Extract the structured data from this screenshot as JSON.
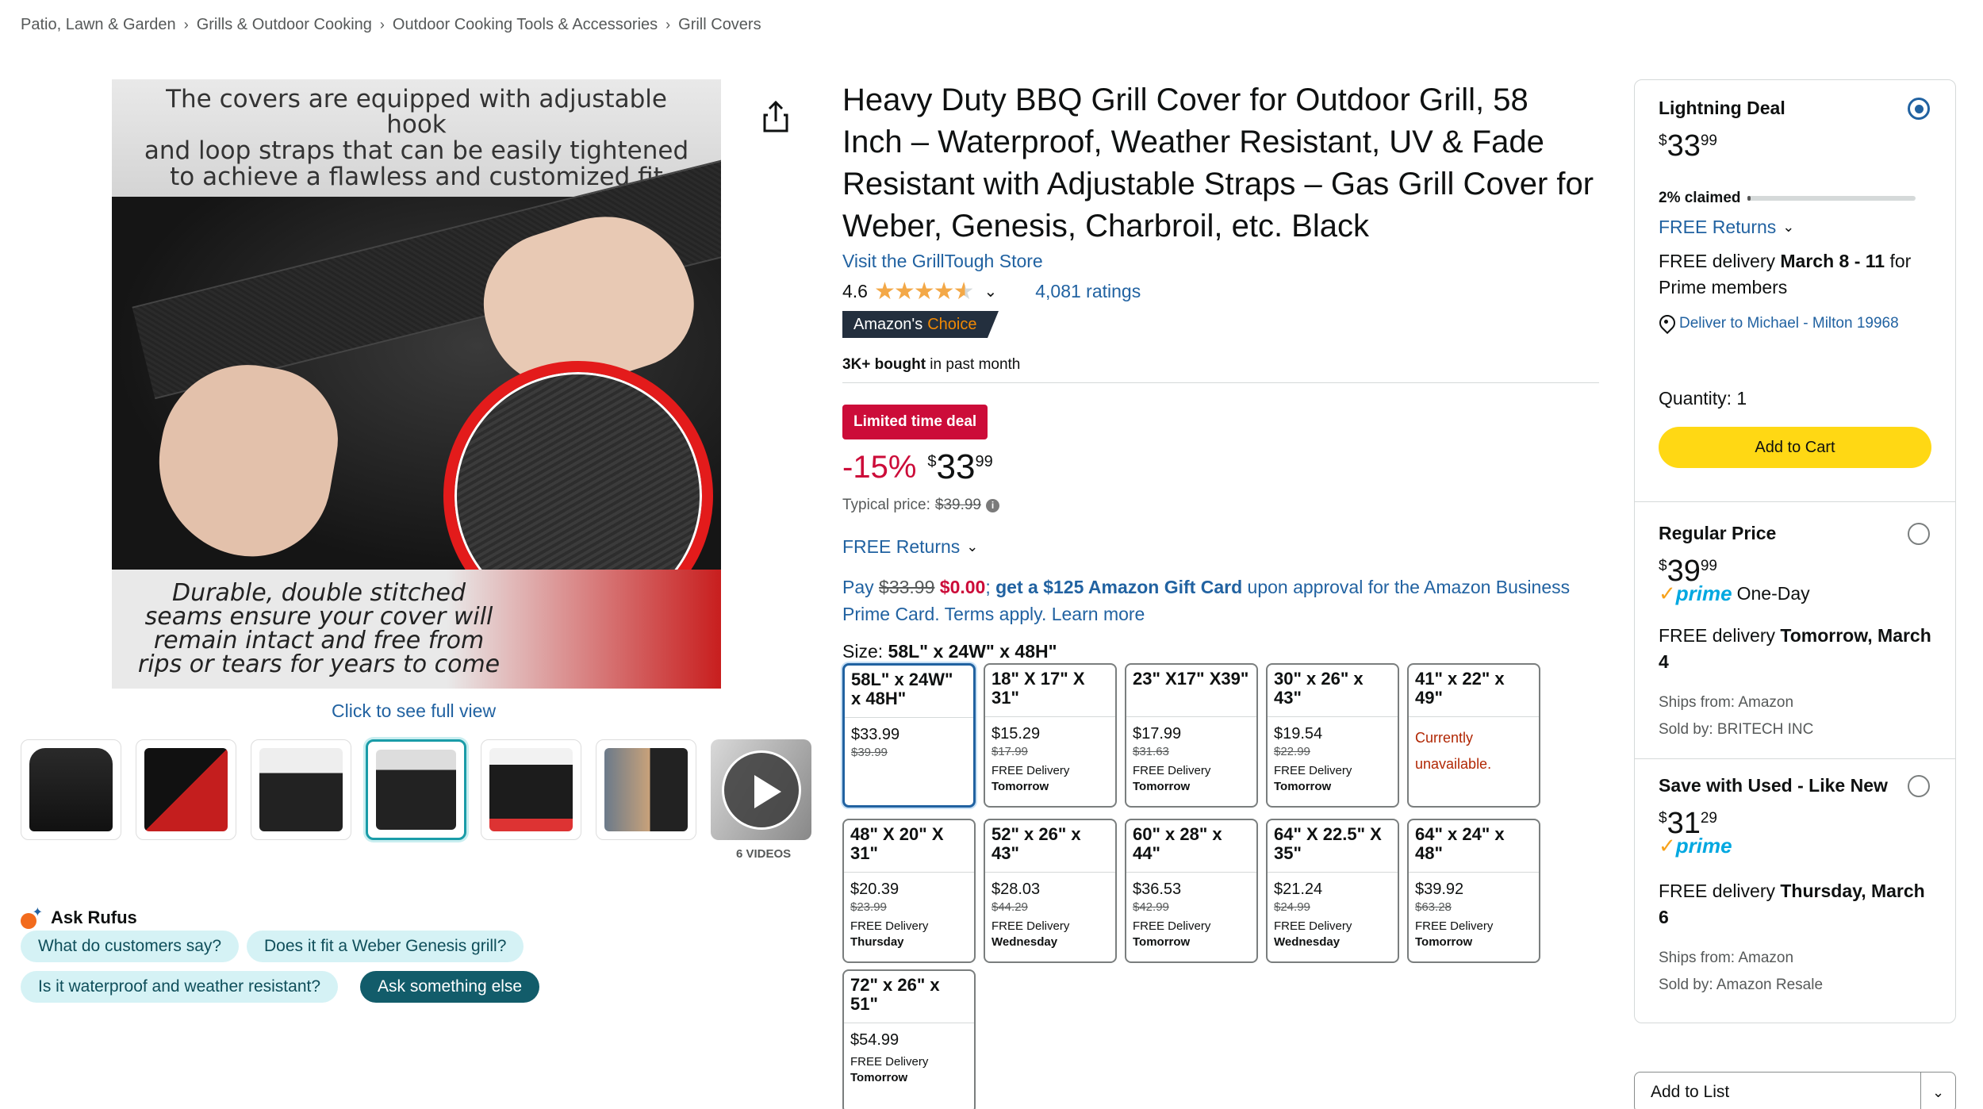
{
  "breadcrumb": [
    "Patio, Lawn & Garden",
    "Grills & Outdoor Cooking",
    "Outdoor Cooking Tools & Accessories",
    "Grill Covers"
  ],
  "main_image": {
    "top_text_1": "The covers are equipped with adjustable hook",
    "top_text_2": "and loop straps that can be easily tightened",
    "top_text_3": "to achieve a flawless and customized fit",
    "bottom_text_1": "Durable, double stitched",
    "bottom_text_2": "seams ensure your cover will",
    "bottom_text_3": "remain intact and free from",
    "bottom_text_4": "rips or tears for years to come"
  },
  "click_full_view": "Click to see full view",
  "videos_label": "6 VIDEOS",
  "rufus": {
    "title": "Ask Rufus",
    "chips": [
      "What do customers say?",
      "Does it fit a Weber Genesis grill?",
      "Is it waterproof and weather resistant?",
      "Ask something else"
    ]
  },
  "product": {
    "title": "Heavy Duty BBQ Grill Cover for Outdoor Grill, 58 Inch – Waterproof, Weather Resistant, UV & Fade Resistant with Adjustable Straps – Gas Grill Cover for Weber, Genesis, Charbroil, etc. Black",
    "store": "Visit the GrillTough Store",
    "rating": "4.6",
    "rating_value": 4.6,
    "ratings_count": "4,081 ratings",
    "choice_1": "Amazon's",
    "choice_2": "Choice",
    "bought_bold": "3K+ bought",
    "bought_rest": " in past month",
    "deal_badge": "Limited time deal",
    "discount": "-15%",
    "currency": "$",
    "price_whole": "33",
    "price_cents": "99",
    "typical_label": "Typical price:",
    "typical_price": "$39.99",
    "free_returns": "FREE Returns",
    "promo": {
      "pay": "Pay ",
      "old": "$33.99",
      "new": "$0.00",
      "semi": "; ",
      "get": "get a $125 Amazon Gift Card",
      "rest": " upon approval for the Amazon Business Prime Card. Terms apply. Learn more"
    },
    "size_label": "Size:",
    "size_value": "58L\" x 24W\" x 48H\""
  },
  "sizes": [
    {
      "size": "58L\" x 24W\" x 48H\"",
      "price": "$33.99",
      "was": "$39.99",
      "d1": "",
      "d2": "",
      "unavailable": ""
    },
    {
      "size": "18\" X 17\" X 31\"",
      "price": "$15.29",
      "was": "$17.99",
      "d1": "FREE Delivery",
      "d2": "Tomorrow",
      "unavailable": ""
    },
    {
      "size": "23\" X17\" X39\"",
      "price": "$17.99",
      "was": "$31.63",
      "d1": "FREE Delivery",
      "d2": "Tomorrow",
      "unavailable": ""
    },
    {
      "size": "30\" x 26\" x 43\"",
      "price": "$19.54",
      "was": "$22.99",
      "d1": "FREE Delivery",
      "d2": "Tomorrow",
      "unavailable": ""
    },
    {
      "size": "41\" x 22\" x 49\"",
      "price": "",
      "was": "",
      "d1": "",
      "d2": "",
      "unavailable": "Currently unavailable."
    },
    {
      "size": "48\" X 20\" X 31\"",
      "price": "$20.39",
      "was": "$23.99",
      "d1": "FREE Delivery",
      "d2": "Thursday",
      "unavailable": ""
    },
    {
      "size": "52\" x 26\" x 43\"",
      "price": "$28.03",
      "was": "$44.29",
      "d1": "FREE Delivery",
      "d2": "Wednesday",
      "unavailable": ""
    },
    {
      "size": "60\" x 28\" x 44\"",
      "price": "$36.53",
      "was": "$42.99",
      "d1": "FREE Delivery",
      "d2": "Tomorrow",
      "unavailable": ""
    },
    {
      "size": "64\" X 22.5\" X 35\"",
      "price": "$21.24",
      "was": "$24.99",
      "d1": "FREE Delivery",
      "d2": "Wednesday",
      "unavailable": ""
    },
    {
      "size": "64\" x 24\" x 48\"",
      "price": "$39.92",
      "was": "$63.28",
      "d1": "FREE Delivery",
      "d2": "Tomorrow",
      "unavailable": ""
    },
    {
      "size": "72\" x 26\" x 51\"",
      "price": "$54.99",
      "was": "",
      "d1": "FREE Delivery",
      "d2": "Tomorrow",
      "unavailable": ""
    }
  ],
  "buybox": {
    "deal": {
      "title": "Lightning Deal",
      "currency": "$",
      "whole": "33",
      "cents": "99",
      "claimed": "2% claimed",
      "claimed_fraction": 0.02,
      "returns": "FREE Returns",
      "delivery_pre": "FREE delivery ",
      "delivery_bold": "March 8 - 11",
      "delivery_post": " for Prime members",
      "deliver_to": "Deliver to Michael - Milton 19968",
      "quantity": "Quantity: 1",
      "add_to_cart": "Add to Cart"
    },
    "regular": {
      "title": "Regular Price",
      "currency": "$",
      "whole": "39",
      "cents": "99",
      "prime": "prime",
      "one_day": "One-Day",
      "delivery_pre": "FREE delivery ",
      "delivery_bold": "Tomorrow, March 4",
      "ships_from": "Ships from: Amazon",
      "sold_by": "Sold by: BRITECH INC"
    },
    "used": {
      "title": "Save with Used - Like New",
      "currency": "$",
      "whole": "31",
      "cents": "29",
      "prime": "prime",
      "delivery_pre": "FREE delivery ",
      "delivery_bold": "Thursday, March 6",
      "ships_from": "Ships from: Amazon",
      "sold_by": "Sold by: Amazon Resale"
    },
    "add_to_list": "Add to List"
  },
  "colors": {
    "link": "#2162a1",
    "deal_red": "#cc0c39",
    "cart_yellow": "#ffd814",
    "star": "#f3a847",
    "rufus_chip": "#d5f2f5",
    "rufus_chip_dark": "#125c6a"
  },
  "icons": [
    "share-icon",
    "star-icon",
    "chevron-down-icon",
    "info-icon",
    "play-icon",
    "location-pin-icon",
    "radio-icon",
    "rufus-icon"
  ]
}
